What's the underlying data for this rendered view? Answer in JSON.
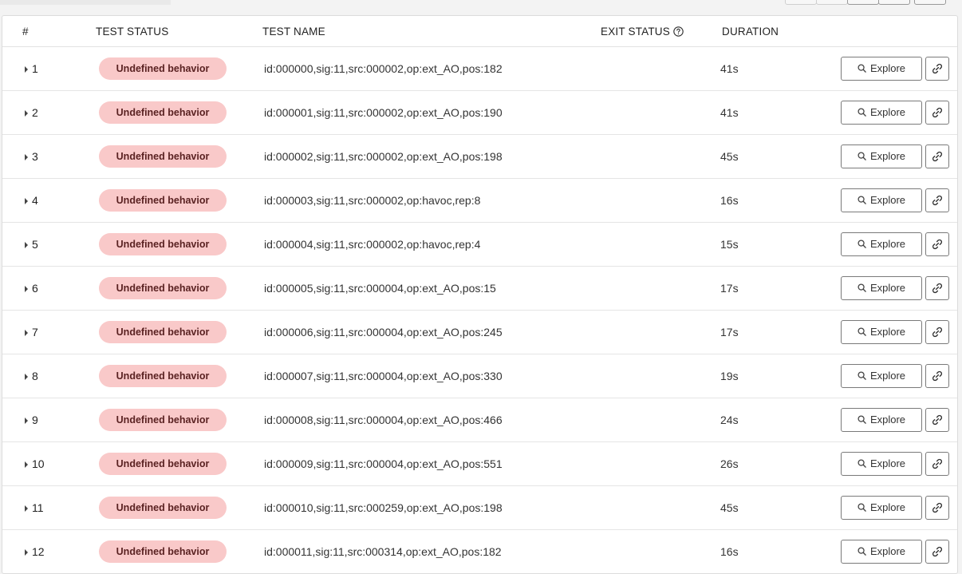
{
  "table": {
    "headers": {
      "index": "#",
      "test_status": "TEST STATUS",
      "test_name": "TEST NAME",
      "exit_status": "EXIT STATUS",
      "duration": "DURATION"
    },
    "explore_label": "Explore",
    "badge_color": "#f9c9c9",
    "rows": [
      {
        "index": "1",
        "status": "Undefined behavior",
        "name": "id:000000,sig:11,src:000002,op:ext_AO,pos:182",
        "exit_status": "",
        "duration": "41s"
      },
      {
        "index": "2",
        "status": "Undefined behavior",
        "name": "id:000001,sig:11,src:000002,op:ext_AO,pos:190",
        "exit_status": "",
        "duration": "41s"
      },
      {
        "index": "3",
        "status": "Undefined behavior",
        "name": "id:000002,sig:11,src:000002,op:ext_AO,pos:198",
        "exit_status": "",
        "duration": "45s"
      },
      {
        "index": "4",
        "status": "Undefined behavior",
        "name": "id:000003,sig:11,src:000002,op:havoc,rep:8",
        "exit_status": "",
        "duration": "16s"
      },
      {
        "index": "5",
        "status": "Undefined behavior",
        "name": "id:000004,sig:11,src:000002,op:havoc,rep:4",
        "exit_status": "",
        "duration": "15s"
      },
      {
        "index": "6",
        "status": "Undefined behavior",
        "name": "id:000005,sig:11,src:000004,op:ext_AO,pos:15",
        "exit_status": "",
        "duration": "17s"
      },
      {
        "index": "7",
        "status": "Undefined behavior",
        "name": "id:000006,sig:11,src:000004,op:ext_AO,pos:245",
        "exit_status": "",
        "duration": "17s"
      },
      {
        "index": "8",
        "status": "Undefined behavior",
        "name": "id:000007,sig:11,src:000004,op:ext_AO,pos:330",
        "exit_status": "",
        "duration": "19s"
      },
      {
        "index": "9",
        "status": "Undefined behavior",
        "name": "id:000008,sig:11,src:000004,op:ext_AO,pos:466",
        "exit_status": "",
        "duration": "24s"
      },
      {
        "index": "10",
        "status": "Undefined behavior",
        "name": "id:000009,sig:11,src:000004,op:ext_AO,pos:551",
        "exit_status": "",
        "duration": "26s"
      },
      {
        "index": "11",
        "status": "Undefined behavior",
        "name": "id:000010,sig:11,src:000259,op:ext_AO,pos:198",
        "exit_status": "",
        "duration": "45s"
      },
      {
        "index": "12",
        "status": "Undefined behavior",
        "name": "id:000011,sig:11,src:000314,op:ext_AO,pos:182",
        "exit_status": "",
        "duration": "16s"
      }
    ]
  }
}
